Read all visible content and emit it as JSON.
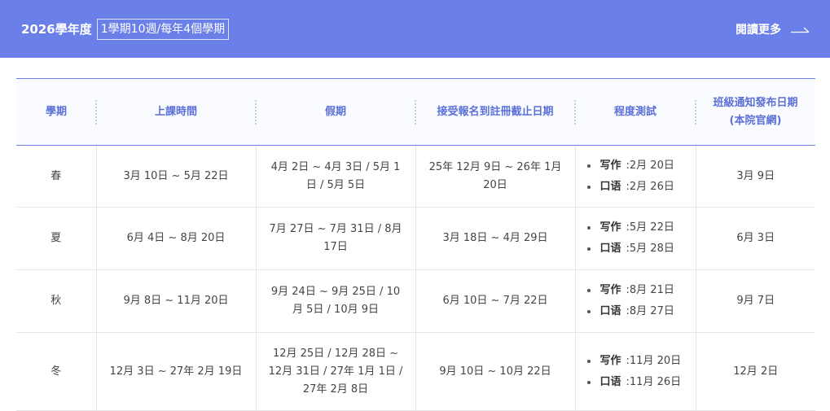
{
  "header": {
    "title": "2026學年度",
    "badge": "1學期10週/每年4個學期",
    "more": "閱讀更多"
  },
  "table": {
    "columns": [
      "學期",
      "上課時間",
      "假期",
      "接受報名到註冊截止日期",
      "程度測試",
      "班級通知發布日期\n(本院官網)"
    ],
    "rows": [
      {
        "term": "春",
        "class_period": "3月 10日 ~ 5月 22日",
        "holidays": "4月 2日 ~ 4月 3日 / 5月 1日 / 5月 5日",
        "registration": "25年 12月 9日 ~ 26年 1月 20日",
        "tests": [
          {
            "name": "写作",
            "date": ":2月 20日"
          },
          {
            "name": "口语",
            "date": ":2月 26日"
          }
        ],
        "announce": "3月 9日"
      },
      {
        "term": "夏",
        "class_period": "6月 4日 ~ 8月 20日",
        "holidays": "7月 27日 ~ 7月 31日 / 8月 17日",
        "registration": "3月 18日 ~ 4月 29日",
        "tests": [
          {
            "name": "写作",
            "date": ":5月 22日"
          },
          {
            "name": "口语",
            "date": ":5月 28日"
          }
        ],
        "announce": "6月 3日"
      },
      {
        "term": "秋",
        "class_period": "9月 8日 ~ 11月 20日",
        "holidays": "9月 24日 ~ 9月 25日 / 10月 5日 / 10月 9日",
        "registration": "6月 10日 ~ 7月 22日",
        "tests": [
          {
            "name": "写作",
            "date": ":8月 21日"
          },
          {
            "name": "口语",
            "date": ":8月 27日"
          }
        ],
        "announce": "9月 7日"
      },
      {
        "term": "冬",
        "class_period": "12月 3日 ~ 27年 2月 19日",
        "holidays": "12月 25日 / 12月 28日 ~ 12月 31日 / 27年 1月 1日 / 27年 2月 8日",
        "registration": "9月 10日 ~ 10月 22日",
        "tests": [
          {
            "name": "写作",
            "date": ":11月 20日"
          },
          {
            "name": "口语",
            "date": ":11月 26日"
          }
        ],
        "announce": "12月 2日"
      }
    ]
  },
  "colors": {
    "accent": "#6a7fe8",
    "header_text": "#5b6fd9"
  },
  "icons": {
    "more": "long-arrow-right-icon"
  }
}
